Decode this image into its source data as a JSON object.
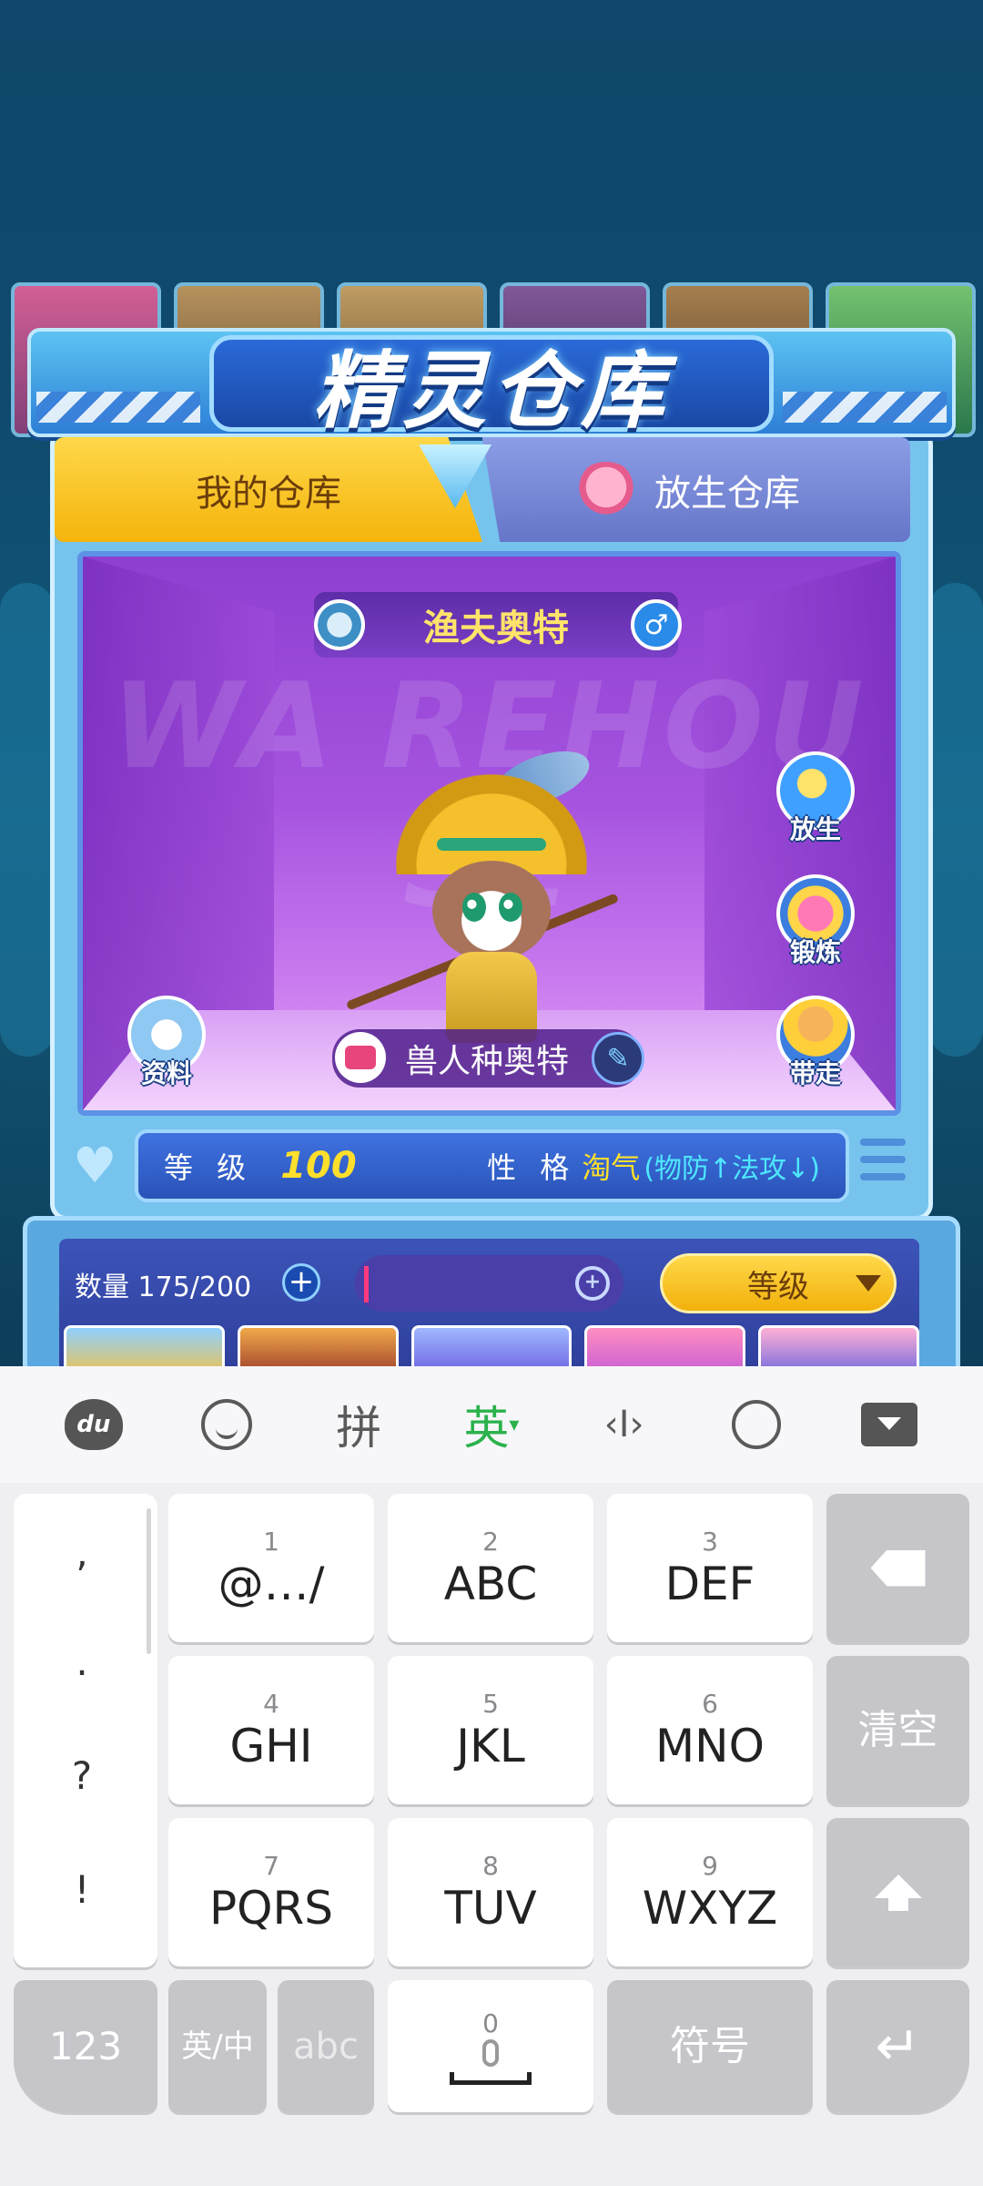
{
  "game": {
    "title": "精灵仓库",
    "tabs": {
      "mine": "我的仓库",
      "release": "放生仓库"
    },
    "watermark": "WA REHOU SE",
    "pet": {
      "name": "渔夫奥特",
      "species": "兽人种奥特",
      "gender_symbol": "♂"
    },
    "actions": {
      "release": "放生",
      "forge": "锻炼",
      "take": "带走",
      "info": "资料"
    },
    "stats": {
      "level_label": "等 级",
      "level_value": "100",
      "nature_label": "性 格",
      "nature_value": "淘气",
      "nature_detail": "(物防↑法攻↓)"
    },
    "storage": {
      "count_label": "数量 175/200",
      "search_value": "",
      "sort_label": "等级"
    }
  },
  "keyboard": {
    "toolbar": {
      "logo": "du",
      "pinyin": "拼",
      "english": "英",
      "cursor": "‹I›"
    },
    "punctuation": [
      ",",
      ".",
      "?",
      "!"
    ],
    "keys": [
      {
        "num": "1",
        "label": "@…/"
      },
      {
        "num": "2",
        "label": "ABC"
      },
      {
        "num": "3",
        "label": "DEF"
      },
      {
        "num": "4",
        "label": "GHI"
      },
      {
        "num": "5",
        "label": "JKL"
      },
      {
        "num": "6",
        "label": "MNO"
      },
      {
        "num": "7",
        "label": "PQRS"
      },
      {
        "num": "8",
        "label": "TUV"
      },
      {
        "num": "9",
        "label": "WXYZ"
      }
    ],
    "clear": "清空",
    "bottom": {
      "num_mode": "123",
      "lang_switch": "英/中",
      "abc": "abc",
      "zero": "0",
      "symbols": "符号"
    }
  }
}
